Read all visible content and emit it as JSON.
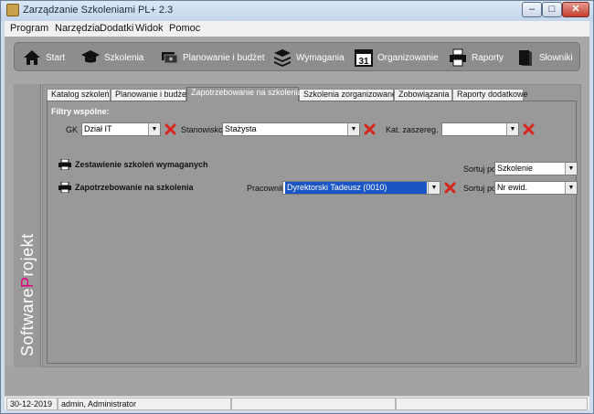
{
  "window": {
    "title": "Zarządzanie Szkoleniami PL+ 2.3",
    "min_glyph": "–",
    "max_glyph": "□",
    "close_glyph": "✕"
  },
  "menu": [
    "Program",
    "Narzędzia",
    "Dodatki",
    "Widok",
    "Pomoc"
  ],
  "toolbar": [
    {
      "label": "Start",
      "icon": "home-icon"
    },
    {
      "label": "Szkolenia",
      "icon": "graduation-cap-icon"
    },
    {
      "label": "Planowanie i budżet",
      "icon": "money-icon"
    },
    {
      "label": "Wymagania",
      "icon": "stack-icon"
    },
    {
      "label": "Organizowanie",
      "icon": "calendar-icon",
      "badge": "31"
    },
    {
      "label": "Raporty",
      "icon": "printer-icon"
    },
    {
      "label": "Słowniki",
      "icon": "book-icon"
    }
  ],
  "brand": {
    "part1": "Software",
    "part2": "P",
    "part3": "rojekt"
  },
  "tabs": [
    "Katalog szkoleń",
    "Planowanie i budżet",
    "Zapotrzebowanie na szkolenia",
    "Szkolenia zorganizowane",
    "Zobowiązania",
    "Raporty dodatkowe"
  ],
  "active_tab_index": 2,
  "filters": {
    "heading": "Filtry wspólne:",
    "gk_label": "GK",
    "gk_value": "Dział IT",
    "position_label": "Stanowisko",
    "position_value": "Stażysta",
    "grade_label": "Kat. zaszereg.",
    "grade_value": ""
  },
  "reports": {
    "required_label": "Zestawienie szkoleń wymaganych",
    "demand_label": "Zapotrzebowanie na szkolenia",
    "employee_label": "Pracownik",
    "employee_value": "Dyrektorski Tadeusz (0010)",
    "sort_label": "Sortuj po:",
    "sort_required_value": "Szkolenie",
    "sort_demand_value": "Nr ewid."
  },
  "status": {
    "date": "30-12-2019",
    "user": "admin, Administrator",
    "cell3": "",
    "cell4": ""
  },
  "colors": {
    "clear_red": "#d8261c",
    "selection_blue": "#1a55c6",
    "brand_accent": "#e5007e"
  }
}
